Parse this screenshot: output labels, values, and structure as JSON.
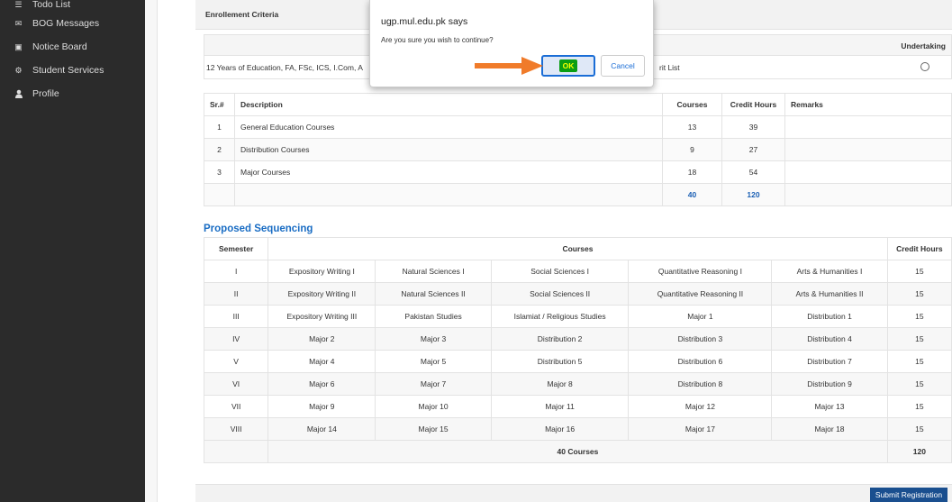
{
  "sidebar": {
    "items": [
      {
        "label": "Todo List",
        "icon": "list-icon"
      },
      {
        "label": "BOG Messages",
        "icon": "envelope-icon"
      },
      {
        "label": "Notice Board",
        "icon": "save-icon"
      },
      {
        "label": "Student Services",
        "icon": "gears-icon"
      },
      {
        "label": "Profile",
        "icon": "user-icon"
      }
    ]
  },
  "criteria": {
    "title": "Enrollement Criteria",
    "undertaking_label": "Undertaking",
    "text_left": "12 Years of Education, FA, FSc, ICS, I.Com, A",
    "text_right": "rit List"
  },
  "course_table": {
    "headers": [
      "Sr.#",
      "Description",
      "Courses",
      "Credit Hours",
      "Remarks"
    ],
    "rows": [
      [
        "1",
        "General Education Courses",
        "13",
        "39",
        ""
      ],
      [
        "2",
        "Distribution Courses",
        "9",
        "27",
        ""
      ],
      [
        "3",
        "Major Courses",
        "18",
        "54",
        ""
      ]
    ],
    "totals": {
      "courses": "40",
      "credit_hours": "120"
    }
  },
  "proposed": {
    "title": "Proposed Sequencing",
    "headers": {
      "semester": "Semester",
      "courses": "Courses",
      "credit_hours": "Credit Hours"
    },
    "rows": [
      {
        "sem": "I",
        "c": [
          "Expository Writing I",
          "Natural Sciences I",
          "Social Sciences I",
          "Quantitative Reasoning I",
          "Arts & Humanities I"
        ],
        "ch": "15"
      },
      {
        "sem": "II",
        "c": [
          "Expository Writing II",
          "Natural Sciences II",
          "Social Sciences II",
          "Quantitative Reasoning II",
          "Arts & Humanities II"
        ],
        "ch": "15"
      },
      {
        "sem": "III",
        "c": [
          "Expository Writing III",
          "Pakistan Studies",
          "Islamiat / Religious Studies",
          "Major 1",
          "Distribution 1"
        ],
        "ch": "15"
      },
      {
        "sem": "IV",
        "c": [
          "Major 2",
          "Major 3",
          "Distribution 2",
          "Distribution 3",
          "Distribution 4"
        ],
        "ch": "15"
      },
      {
        "sem": "V",
        "c": [
          "Major 4",
          "Major 5",
          "Distribution 5",
          "Distribution 6",
          "Distribution 7"
        ],
        "ch": "15"
      },
      {
        "sem": "VI",
        "c": [
          "Major 6",
          "Major 7",
          "Major 8",
          "Distribution 8",
          "Distribution 9"
        ],
        "ch": "15"
      },
      {
        "sem": "VII",
        "c": [
          "Major 9",
          "Major 10",
          "Major 11",
          "Major 12",
          "Major 13"
        ],
        "ch": "15"
      },
      {
        "sem": "VIII",
        "c": [
          "Major 14",
          "Major 15",
          "Major 16",
          "Major 17",
          "Major 18"
        ],
        "ch": "15"
      }
    ],
    "total_label": "40 Courses",
    "total_hours": "120"
  },
  "submit_label": "Submit Registration",
  "dialog": {
    "site": "ugp.mul.edu.pk says",
    "message": "Are you sure you wish to continue?",
    "ok_label": "OK",
    "cancel_label": "Cancel"
  },
  "colors": {
    "sidebar_bg": "#2b2b2b",
    "accent_blue": "#1a6dc4",
    "ok_highlight": "#0a9e13",
    "arrow": "#f07b2a"
  }
}
